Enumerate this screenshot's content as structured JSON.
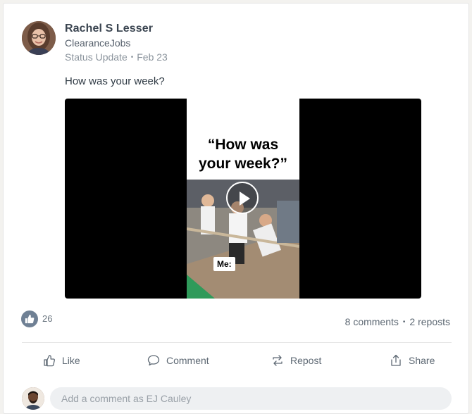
{
  "post": {
    "author_name": "Rachel S Lesser",
    "author_org": "ClearanceJobs",
    "type": "Status Update",
    "date": "Feb 23",
    "text": "How was your week?"
  },
  "video": {
    "caption_line1": "“How was",
    "caption_line2": "your week?”",
    "overlay_label": "Me:"
  },
  "engagement": {
    "likes": "26",
    "comments": "8 comments",
    "reposts": "2 reposts"
  },
  "actions": {
    "like": "Like",
    "comment": "Comment",
    "repost": "Repost",
    "share": "Share"
  },
  "comment_box": {
    "placeholder": "Add a comment as EJ Cauley"
  },
  "colors": {
    "like_badge": "#6f8094",
    "text_primary": "#3a4450",
    "text_muted": "#8a939c"
  }
}
